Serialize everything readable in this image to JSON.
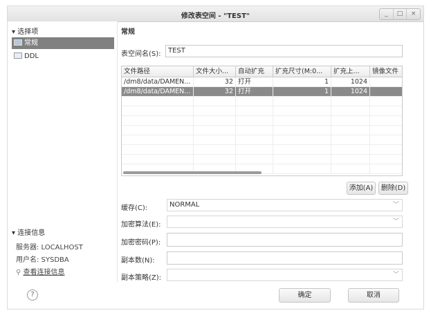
{
  "window": {
    "title": "修改表空间 - \"TEST\"",
    "controls": [
      "_",
      "□",
      "×"
    ]
  },
  "left": {
    "options_header": "选择项",
    "nav": [
      {
        "label": "常规"
      },
      {
        "label": "DDL"
      }
    ],
    "conn_header": "连接信息",
    "server": "服务器: LOCALHOST",
    "user": "用户名: SYSDBA",
    "view_link": "查看连接信息"
  },
  "main": {
    "section": "常规",
    "tsname_label": "表空间名(S):",
    "tsname_value": "TEST",
    "table": {
      "headers": [
        "文件路径",
        "文件大小...",
        "自动扩充",
        "扩充尺寸(M:0...",
        "扩充上...",
        "镜像文件"
      ],
      "rows": [
        [
          "/dm8/data/DAMEN...",
          "32",
          "打开",
          "1",
          "1024",
          ""
        ],
        [
          "/dm8/data/DAMEN...",
          "32",
          "打开",
          "1",
          "1024",
          ""
        ]
      ]
    },
    "add_label": "添加(A)",
    "delete_label": "删除(D)",
    "cache_label": "缓存(C):",
    "cache_value": "NORMAL",
    "enc_algo_label": "加密算法(E):",
    "enc_pwd_label": "加密密码(P):",
    "copies_label": "副本数(N):",
    "policy_label": "副本策略(Z):"
  },
  "footer": {
    "help": "?",
    "ok": "确定",
    "cancel": "取消"
  }
}
